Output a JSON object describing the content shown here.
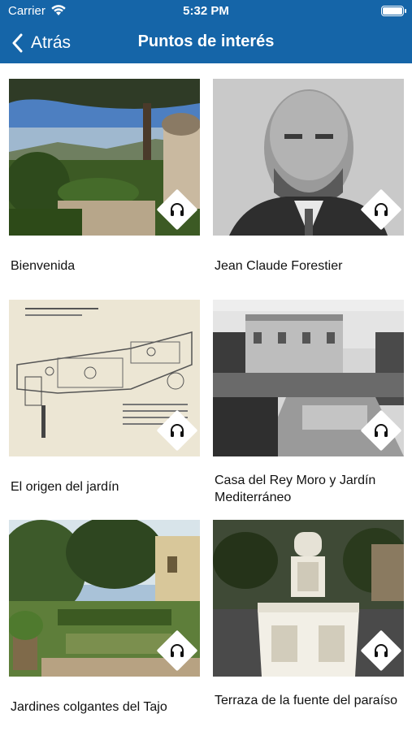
{
  "status": {
    "carrier": "Carrier",
    "time": "5:32 PM"
  },
  "nav": {
    "back_label": "Atrás",
    "title": "Puntos de interés"
  },
  "items": [
    {
      "title": "Bienvenida",
      "icon": "headphones-icon"
    },
    {
      "title": "Jean Claude Forestier",
      "icon": "headphones-icon"
    },
    {
      "title": "El origen del jardín",
      "icon": "headphones-icon"
    },
    {
      "title": "Casa del Rey Moro y Jardín Mediterráneo",
      "icon": "headphones-icon"
    },
    {
      "title": "Jardines colgantes del Tajo",
      "icon": "headphones-icon"
    },
    {
      "title": "Terraza de la fuente del paraíso",
      "icon": "headphones-icon"
    }
  ],
  "colors": {
    "accent": "#1565a8"
  }
}
